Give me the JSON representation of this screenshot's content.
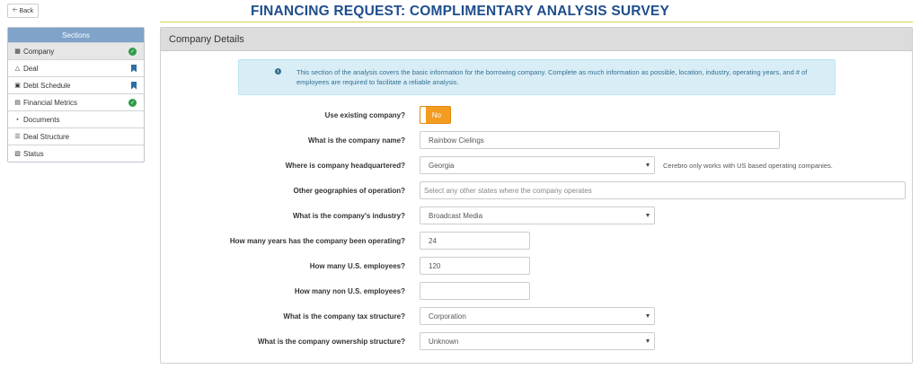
{
  "header": {
    "back_label": "Back",
    "title": "FINANCING REQUEST: COMPLIMENTARY ANALYSIS SURVEY"
  },
  "sidebar": {
    "title": "Sections",
    "items": [
      {
        "label": "Company",
        "icon": "building-icon",
        "status": "complete",
        "active": true
      },
      {
        "label": "Deal",
        "icon": "handshake-icon",
        "status": "bookmarked"
      },
      {
        "label": "Debt Schedule",
        "icon": "calendar-icon",
        "status": "bookmarked"
      },
      {
        "label": "Financial Metrics",
        "icon": "document-icon",
        "status": "complete"
      },
      {
        "label": "Documents",
        "icon": "paperclip-icon",
        "status": "none"
      },
      {
        "label": "Deal Structure",
        "icon": "layers-icon",
        "status": "none"
      },
      {
        "label": "Status",
        "icon": "list-icon",
        "status": "none"
      }
    ]
  },
  "panel": {
    "title": "Company Details",
    "info": "This section of the analysis covers the basic information for the borrowing company. Complete as much information as possible, location, industry, operating years, and # of employees are required to facilitate a reliable analysis."
  },
  "form": {
    "use_existing": {
      "label": "Use existing company?",
      "value": "No"
    },
    "company_name": {
      "label": "What is the company name?",
      "value": "Rainbow Cielings"
    },
    "headquarters": {
      "label": "Where is company headquartered?",
      "value": "Georgia",
      "hint": "Cerebro only works with US based operating companies."
    },
    "geographies": {
      "label": "Other geographies of operation?",
      "placeholder": "Select any other states where the company operates"
    },
    "industry": {
      "label": "What is the company's industry?",
      "value": "Broadcast Media"
    },
    "years": {
      "label": "How many years has the company been operating?",
      "value": "24"
    },
    "us_employees": {
      "label": "How many U.S. employees?",
      "value": "120"
    },
    "non_us_employees": {
      "label": "How many non U.S. employees?",
      "value": ""
    },
    "tax_structure": {
      "label": "What is the company tax structure?",
      "value": "Corporation"
    },
    "ownership": {
      "label": "What is the company ownership structure?",
      "value": "Unknown"
    }
  },
  "colors": {
    "title": "#1f4e8c",
    "accent_toggle": "#f39c1f",
    "check": "#2e9b49",
    "bookmark": "#2f6ea5",
    "info_bg": "#d9edf7"
  }
}
